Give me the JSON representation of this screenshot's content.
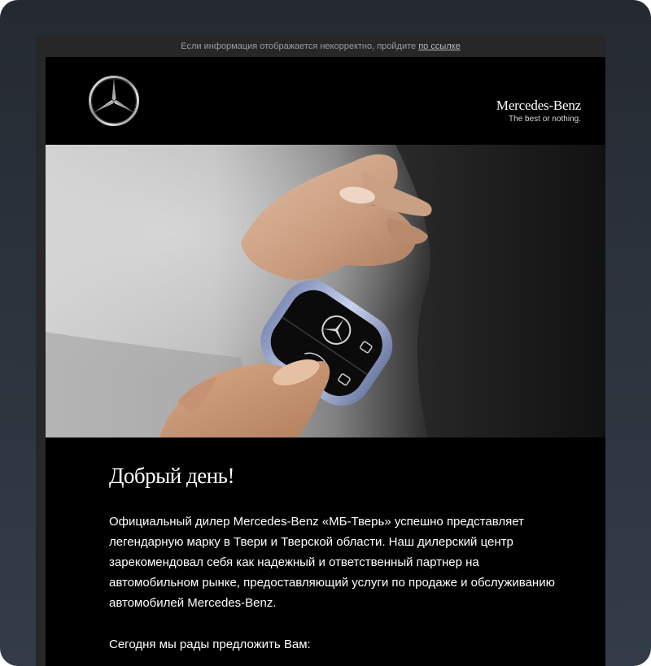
{
  "notice": {
    "text": "Если информация отображается некорректно, пройдите",
    "link_label": "по ссылке"
  },
  "header": {
    "logo_icon": "mercedes-star-icon",
    "brand_name": "Mercedes-Benz",
    "brand_tagline": "The best or nothing."
  },
  "hero": {
    "icon": "car-key-handover-photo"
  },
  "body": {
    "greeting": "Добрый день!",
    "paragraph_lines": [
      "Официальный дилер Mercedes-Benz «МБ-Тверь» успешно представляет",
      "легендарную марку в Твери и Тверской области. Наш дилерский центр",
      "зарекомендовал себя как надежный и ответственный партнер на",
      "автомобильном рынке, предоставляющий услуги по продаже и обслуживанию",
      "автомобилей Mercedes-Benz."
    ],
    "offer_intro": "Сегодня мы рады предложить Вам:"
  },
  "colors": {
    "page_bg": "#2c343e",
    "email_frame": "#272727",
    "card_bg": "#000000",
    "text": "#ffffff",
    "notice_text": "#9a9a9a"
  }
}
